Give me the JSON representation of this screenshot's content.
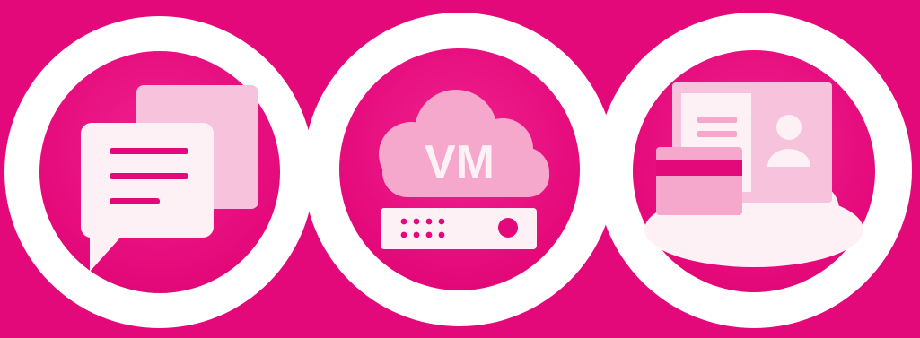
{
  "colors": {
    "background": "#e4097a",
    "ring": "#ffffff",
    "disc": "#e4097a",
    "tile_light": "#fdf1f6",
    "tile_mid": "#f5a8cc",
    "tile_soft": "#f7c2db",
    "accent_line": "#e4097a"
  },
  "icons": {
    "chat": {
      "name": "chat-documents-icon"
    },
    "vm": {
      "name": "cloud-vm-server-icon",
      "label": "VM"
    },
    "portal": {
      "name": "cloud-id-card-icon"
    }
  }
}
